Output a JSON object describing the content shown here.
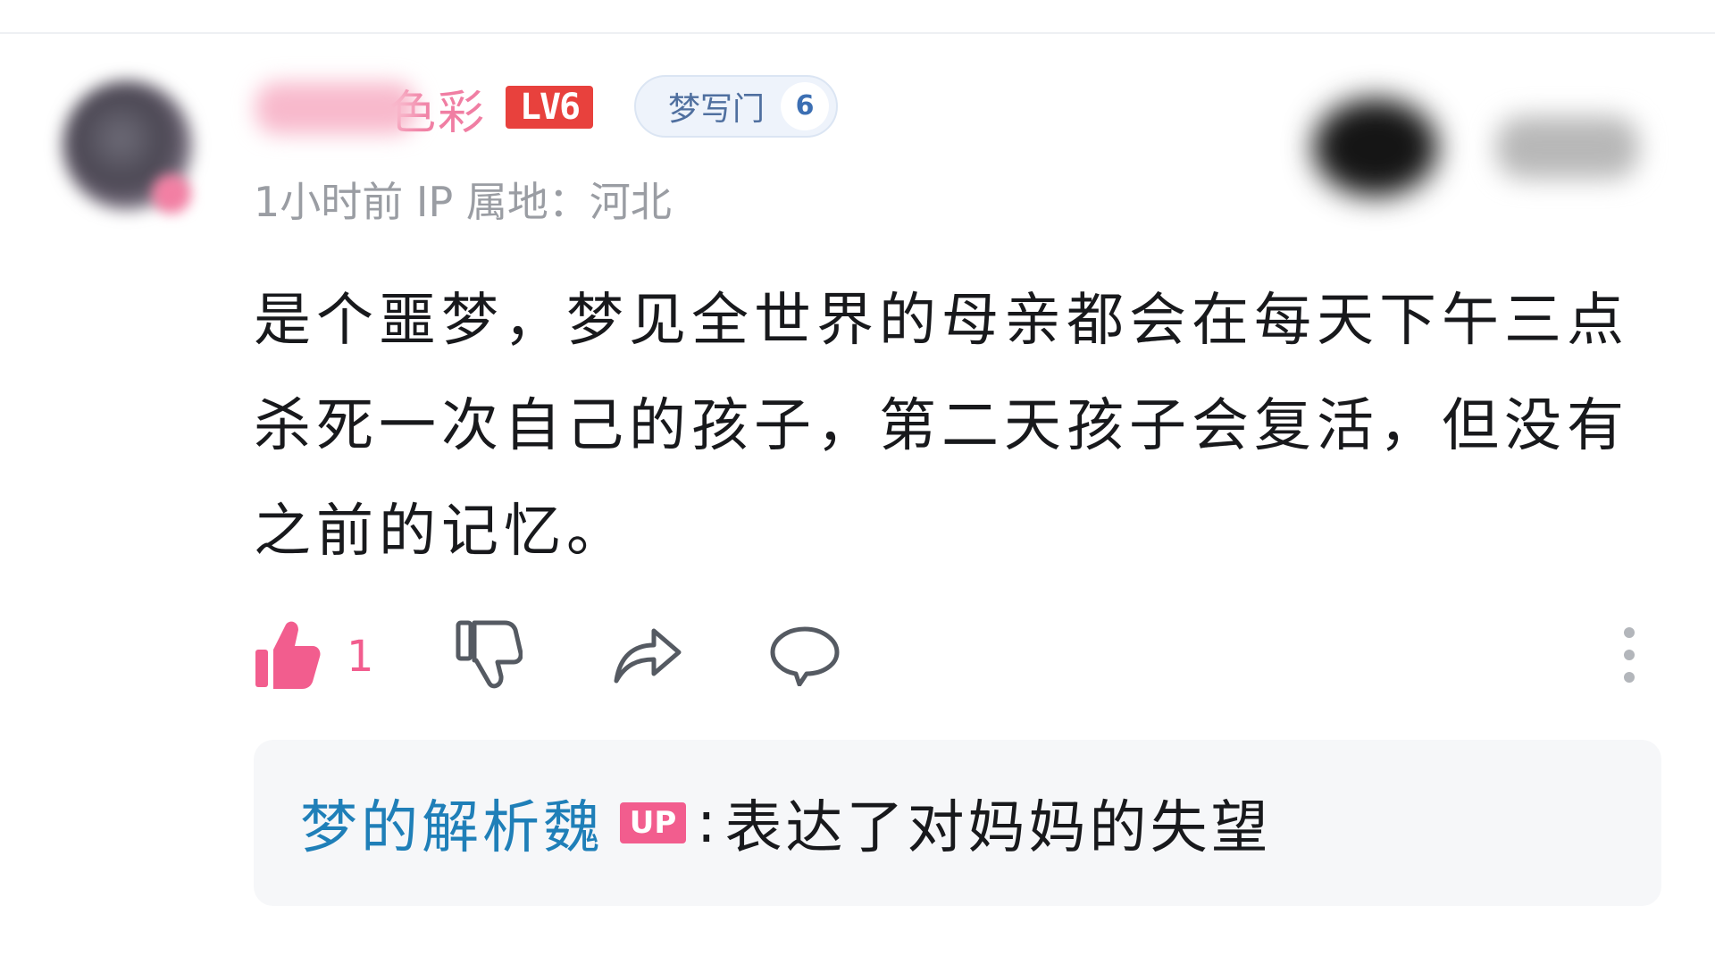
{
  "comment": {
    "username_visible": "色彩",
    "level_badge": "LV6",
    "fan_medal": {
      "label": "梦写门",
      "level": "6"
    },
    "time": "1小时前",
    "ip_location": "IP 属地：河北",
    "text": "是个噩梦，梦见全世界的母亲都会在每天下午三点杀死一次自己的孩子，第二天孩子会复活，但没有之前的记忆。",
    "like_count": "1"
  },
  "sub_reply": {
    "author": "梦的解析魏",
    "badge": "UP",
    "separator": ":",
    "text": "表达了对妈妈的失望"
  },
  "icons": {
    "like": "thumbs-up-icon",
    "dislike": "thumbs-down-icon",
    "share": "share-icon",
    "reply": "comment-bubble-icon",
    "more": "more-vertical-icon"
  },
  "colors": {
    "accent_pink": "#f25d8e",
    "level_red": "#e8413d",
    "reply_author_blue": "#1f7fb8",
    "meta_gray": "#9a9da3"
  }
}
